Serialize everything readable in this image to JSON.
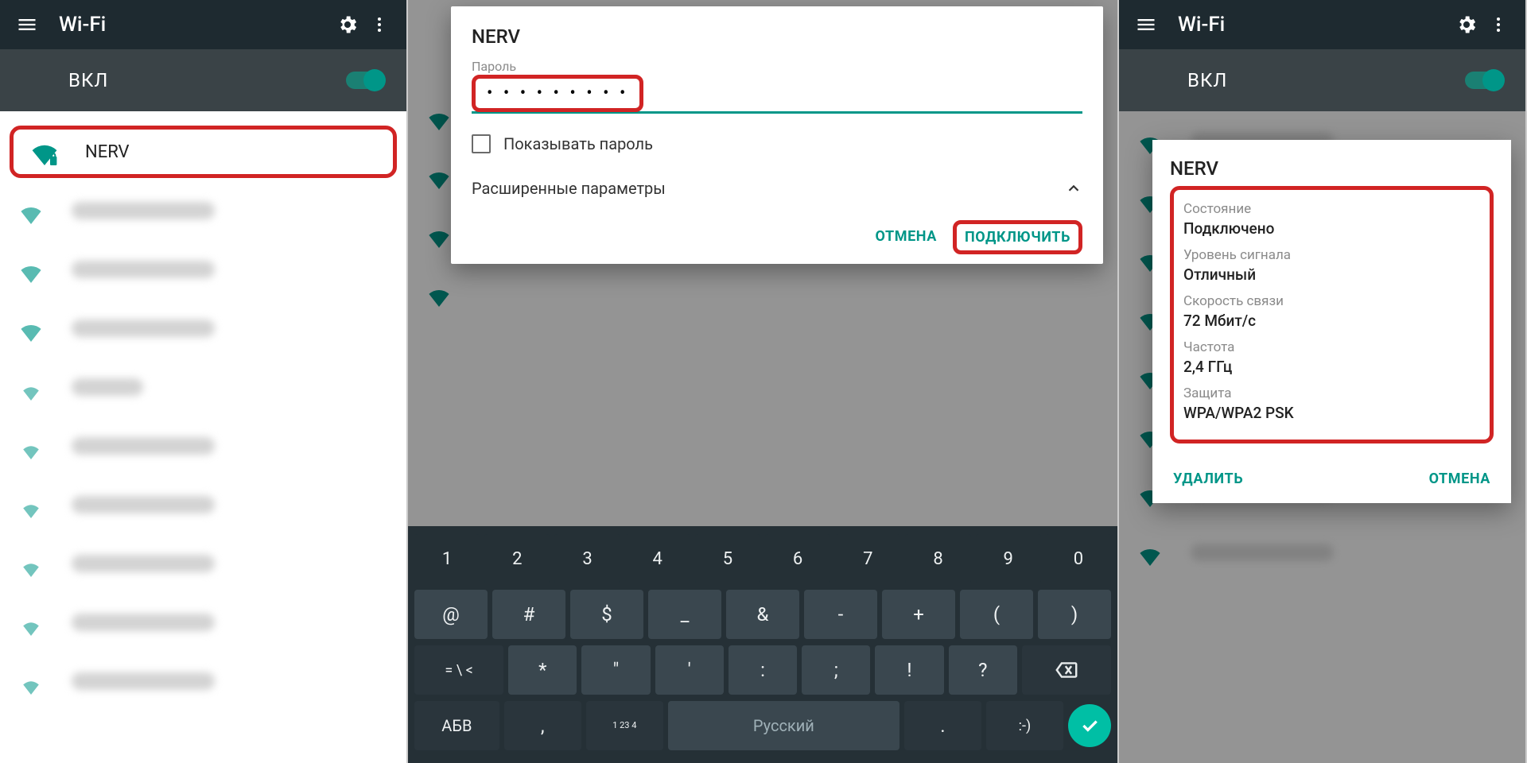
{
  "common": {
    "appbar_title": "Wi-Fi",
    "toggle_label": "ВКЛ"
  },
  "panel1": {
    "highlighted_network": "NERV"
  },
  "panel2": {
    "dialog": {
      "title": "NERV",
      "password_label": "Пароль",
      "password_masked": "• • • • • • • • •",
      "show_password": "Показывать пароль",
      "advanced": "Расширенные параметры",
      "action_cancel": "ОТМЕНА",
      "action_connect": "ПОДКЛЮЧИТЬ"
    },
    "keyboard": {
      "row_nums": [
        "1",
        "2",
        "3",
        "4",
        "5",
        "6",
        "7",
        "8",
        "9",
        "0"
      ],
      "row_sym1": [
        "@",
        "#",
        "$",
        "_",
        "&",
        "-",
        "+",
        "(",
        ")"
      ],
      "row_sym2": [
        "*",
        "\"",
        "'",
        ":",
        ";",
        "!",
        "?"
      ],
      "switch_special_top": "= \\ <",
      "switch_abc": "АБВ",
      "under_top": "1 2",
      "under_bot": "3 4",
      "comma": ",",
      "space": "Русский",
      "dot": ".",
      "smiley": ":-)"
    }
  },
  "panel3": {
    "dialog": {
      "title": "NERV",
      "items": [
        {
          "label": "Состояние",
          "value": "Подключено"
        },
        {
          "label": "Уровень сигнала",
          "value": "Отличный"
        },
        {
          "label": "Скорость связи",
          "value": "72 Мбит/с"
        },
        {
          "label": "Частота",
          "value": "2,4 ГГц"
        },
        {
          "label": "Защита",
          "value": "WPA/WPA2 PSK"
        }
      ],
      "action_forget": "УДАЛИТЬ",
      "action_cancel": "ОТМЕНА"
    }
  }
}
